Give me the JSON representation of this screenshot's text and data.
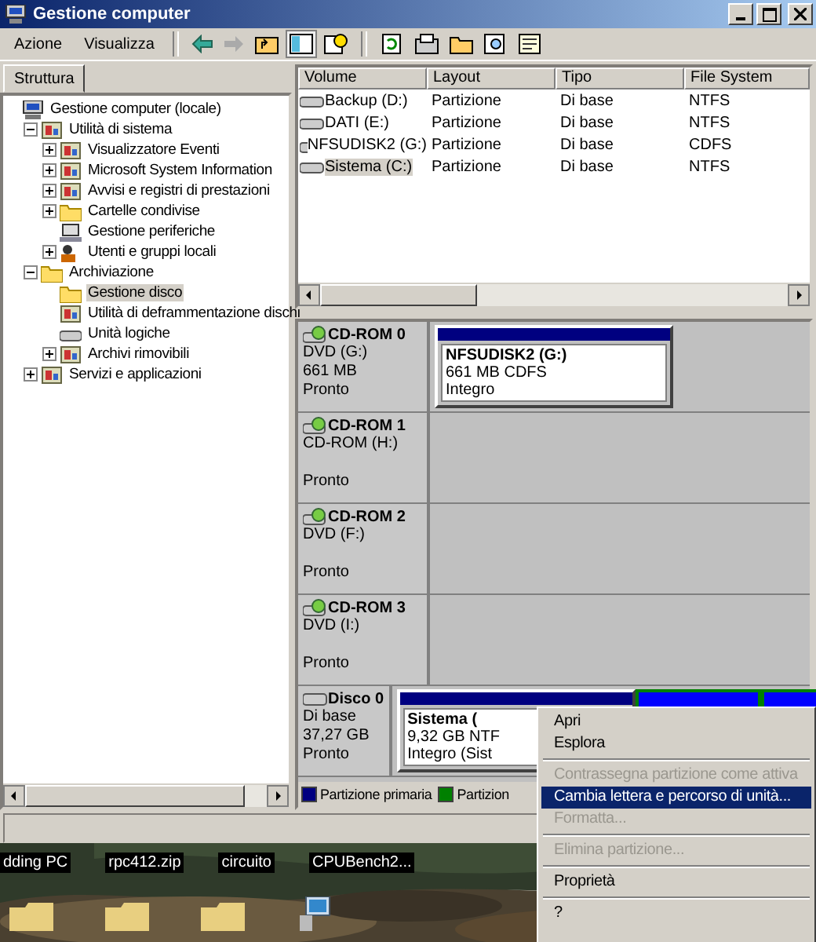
{
  "window": {
    "title": "Gestione computer"
  },
  "menu": [
    "Azione",
    "Visualizza"
  ],
  "tabs": [
    {
      "label": "Struttura",
      "selected": true
    }
  ],
  "tree": [
    {
      "label": "Gestione computer (locale)",
      "selected": false,
      "children": [
        {
          "label": "Utilità di sistema",
          "selected": false,
          "expanded": true,
          "children": [
            {
              "label": "Visualizzatore Eventi",
              "selected": false,
              "expanded": false
            },
            {
              "label": "Microsoft System Information",
              "selected": false,
              "expanded": false
            },
            {
              "label": "Avvisi e registri di prestazioni",
              "selected": false,
              "expanded": false
            },
            {
              "label": "Cartelle condivise",
              "selected": false,
              "expanded": false
            },
            {
              "label": "Gestione periferiche",
              "selected": false
            },
            {
              "label": "Utenti e gruppi locali",
              "selected": false,
              "expanded": false
            }
          ]
        },
        {
          "label": "Archiviazione",
          "selected": false,
          "expanded": true,
          "children": [
            {
              "label": "Gestione disco",
              "selected": true
            },
            {
              "label": "Utilità di deframmentazione dischi",
              "selected": false
            },
            {
              "label": "Unità logiche",
              "selected": false
            },
            {
              "label": "Archivi rimovibili",
              "selected": false,
              "expanded": false
            }
          ]
        },
        {
          "label": "Servizi e applicazioni",
          "selected": false,
          "expanded": false
        }
      ]
    }
  ],
  "volumes": {
    "columns": [
      "Volume",
      "Layout",
      "Tipo",
      "File System"
    ],
    "rows": [
      {
        "kind": "drive",
        "volume": "Backup (D:)",
        "layout": "Partizione",
        "tipo": "Di base",
        "fs": "NTFS",
        "selected": false
      },
      {
        "kind": "drive",
        "volume": "DATI (E:)",
        "layout": "Partizione",
        "tipo": "Di base",
        "fs": "NTFS",
        "selected": false
      },
      {
        "kind": "cdrom",
        "volume": "NFSUDISK2 (G:)",
        "layout": "Partizione",
        "tipo": "Di base",
        "fs": "CDFS",
        "selected": false
      },
      {
        "kind": "drive",
        "volume": "Sistema (C:)",
        "layout": "Partizione",
        "tipo": "Di base",
        "fs": "NTFS",
        "selected": true
      }
    ]
  },
  "disks": [
    {
      "kind": "cdrom",
      "name": "CD-ROM 0",
      "type": "DVD (G:)",
      "size": "661 MB",
      "status": "Pronto",
      "partitions": [
        {
          "kind": "primary",
          "color": "#000080",
          "name": "NFSUDISK2  (G:)",
          "size": "661 MB CDFS",
          "status": "Integro"
        }
      ]
    },
    {
      "kind": "cdrom",
      "name": "CD-ROM 1",
      "type": "CD-ROM (H:)",
      "status": "Pronto"
    },
    {
      "kind": "cdrom",
      "name": "CD-ROM 2",
      "type": "DVD (F:)",
      "status": "Pronto"
    },
    {
      "kind": "cdrom",
      "name": "CD-ROM 3",
      "type": "DVD (I:)",
      "status": "Pronto"
    },
    {
      "kind": "disk",
      "name": "Disco 0",
      "type": "Di base",
      "size": "37,27 GB",
      "status": "Pronto",
      "partitions": [
        {
          "kind": "primary",
          "color": "#000080",
          "name": "Sistema  (",
          "size": "9,32 GB NTF",
          "status": "Integro (Sist"
        },
        {
          "kind": "logical",
          "color": "#0000ff"
        },
        {
          "kind": "logical",
          "color": "#0000ff"
        }
      ]
    }
  ],
  "legend": [
    {
      "label": "Partizione primaria",
      "color": "#000080"
    },
    {
      "label": "Partizion",
      "color": "#008000"
    }
  ],
  "context_menu": [
    {
      "kind": "item",
      "label": "Apri",
      "disabled": false,
      "selected": false
    },
    {
      "kind": "item",
      "label": "Esplora",
      "disabled": false,
      "selected": false
    },
    {
      "kind": "separator"
    },
    {
      "kind": "item",
      "label": "Contrassegna partizione come attiva",
      "disabled": true,
      "selected": false
    },
    {
      "kind": "item",
      "label": "Cambia lettera e percorso di unità...",
      "disabled": false,
      "selected": true
    },
    {
      "kind": "item",
      "label": "Formatta...",
      "disabled": true,
      "selected": false
    },
    {
      "kind": "separator"
    },
    {
      "kind": "item",
      "label": "Elimina partizione...",
      "disabled": true,
      "selected": false
    },
    {
      "kind": "separator"
    },
    {
      "kind": "item",
      "label": "Proprietà",
      "disabled": false,
      "selected": false
    },
    {
      "kind": "separator"
    },
    {
      "kind": "item",
      "label": "?",
      "disabled": false,
      "selected": false
    }
  ],
  "desktop": {
    "icons": [
      "dding PC",
      "rpc412.zip",
      "circuito",
      "CPUBench2..."
    ]
  }
}
